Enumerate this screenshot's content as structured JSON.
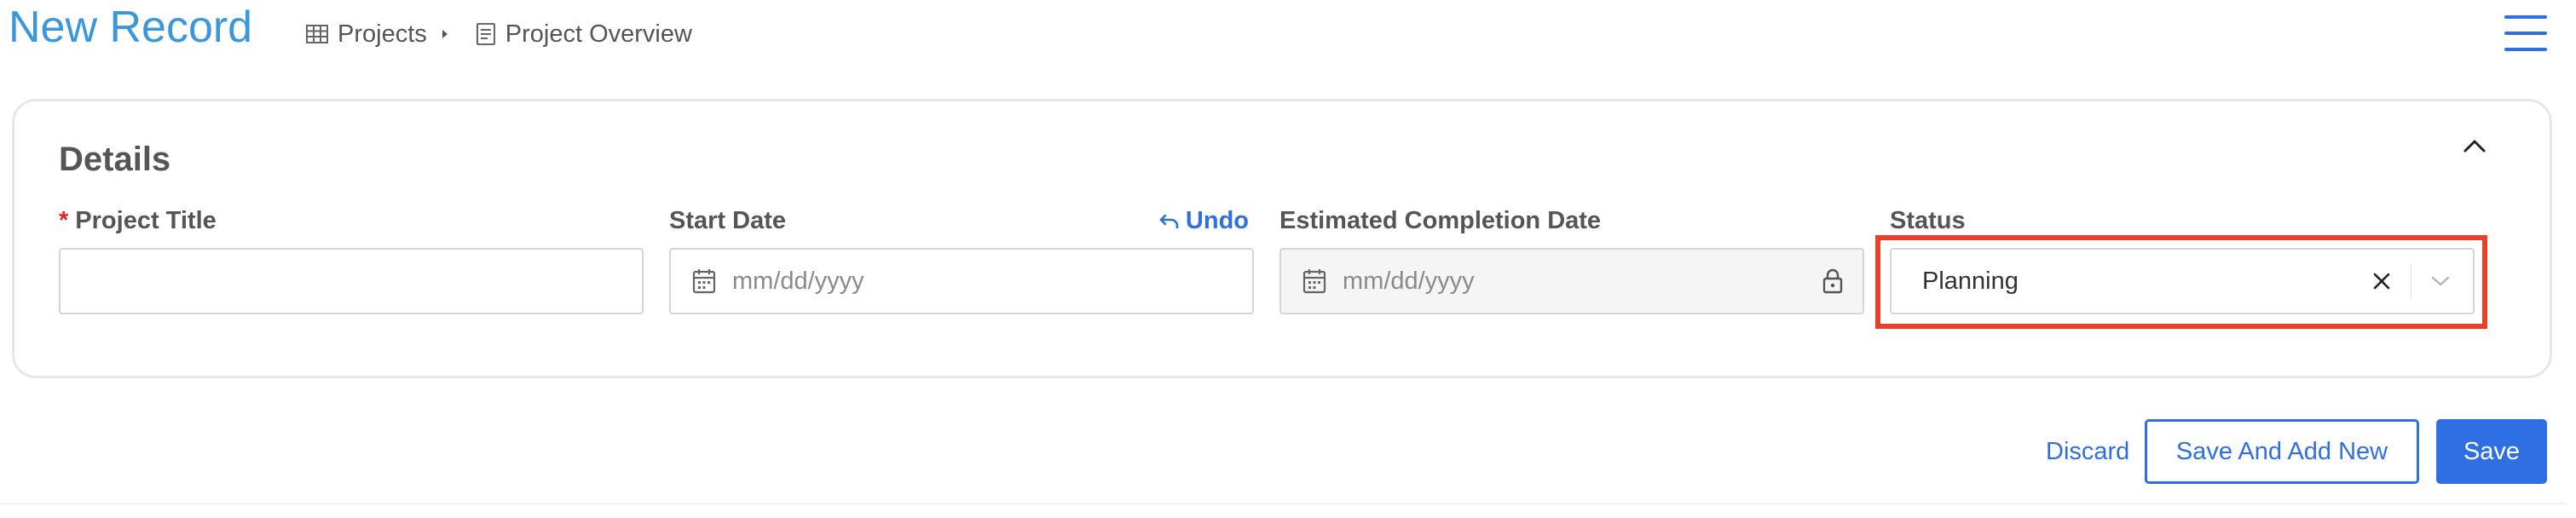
{
  "page": {
    "title": "New Record"
  },
  "breadcrumb": {
    "items": [
      {
        "label": "Projects",
        "icon": "table-icon"
      },
      {
        "label": "Project Overview",
        "icon": "document-icon"
      }
    ]
  },
  "details": {
    "title": "Details",
    "fields": {
      "project_title": {
        "label": "Project Title",
        "required_mark": "*",
        "value": ""
      },
      "start_date": {
        "label": "Start Date",
        "placeholder": "mm/dd/yyyy",
        "undo_label": "Undo"
      },
      "estimated_completion_date": {
        "label": "Estimated Completion Date",
        "placeholder": "mm/dd/yyyy",
        "locked": true
      },
      "status": {
        "label": "Status",
        "value": "Planning"
      }
    }
  },
  "actions": {
    "discard_label": "Discard",
    "save_and_add_new_label": "Save And Add New",
    "save_label": "Save"
  },
  "colors": {
    "accent": "#2f6fe4",
    "title": "#3a97dc",
    "highlight": "#e5412b",
    "required": "#e0262b"
  }
}
